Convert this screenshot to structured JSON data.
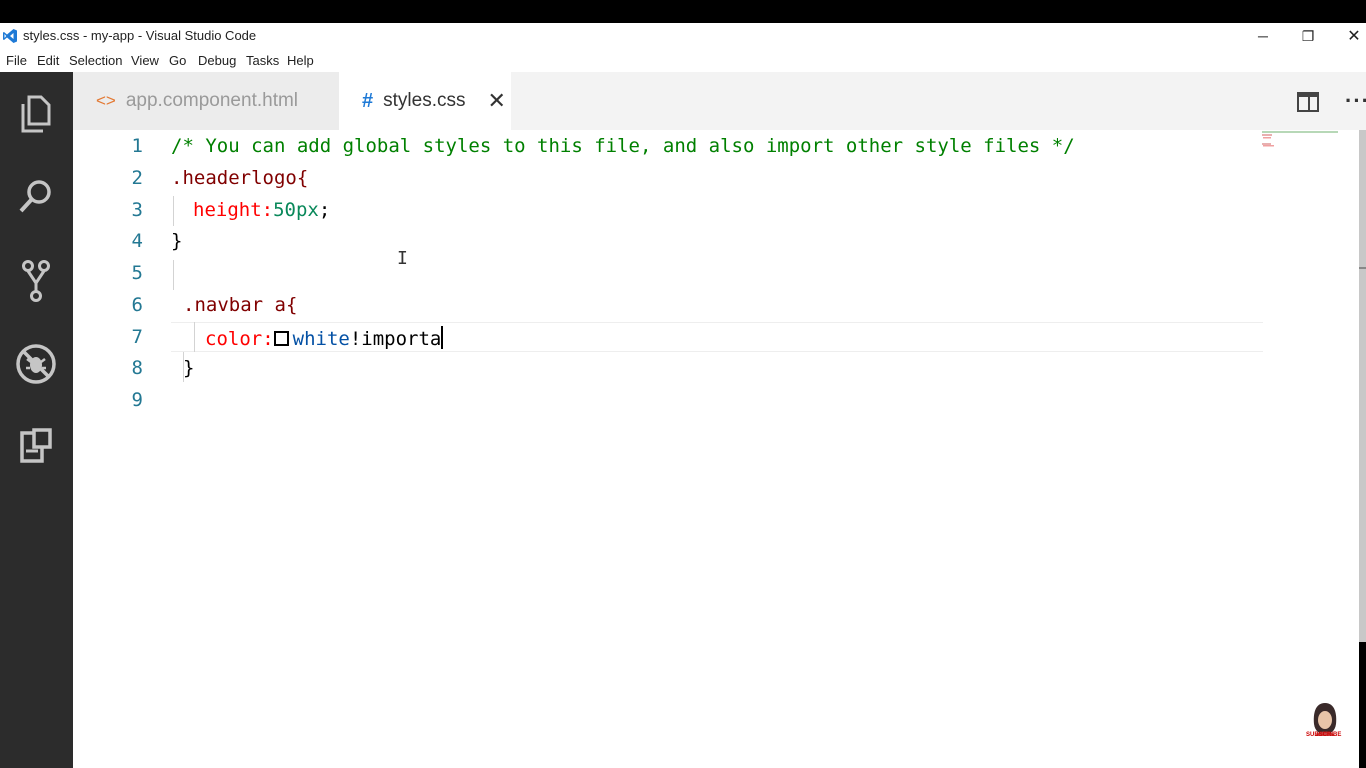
{
  "window": {
    "title": "styles.css - my-app - Visual Studio Code",
    "controls": {
      "minimize": "─",
      "restore": "❐",
      "close": "✕"
    }
  },
  "menu": [
    "File",
    "Edit",
    "Selection",
    "View",
    "Go",
    "Debug",
    "Tasks",
    "Help"
  ],
  "activity_bar": [
    "explorer-icon",
    "search-icon",
    "source-control-icon",
    "debug-icon",
    "extensions-icon"
  ],
  "tabs": [
    {
      "icon": "<>",
      "label": "app.component.html",
      "active": false
    },
    {
      "icon": "#",
      "label": "styles.css",
      "active": true,
      "close": "✕"
    }
  ],
  "editor": {
    "line_numbers": [
      "1",
      "2",
      "3",
      "4",
      "5",
      "6",
      "7",
      "8",
      "9"
    ],
    "lines": {
      "l1": "/* You can add global styles to this file, and also import other style files */",
      "l2": ".headerlogo{",
      "l3_prop": "height:",
      "l3_val": "50px",
      "l3_end": ";",
      "l4": "}",
      "l6": ".navbar a{",
      "l7_prop": "color:",
      "l7_val": "white",
      "l7_rest": "!importa",
      "l8": "}"
    }
  },
  "subscribe_label": "SUBSCRIBE"
}
